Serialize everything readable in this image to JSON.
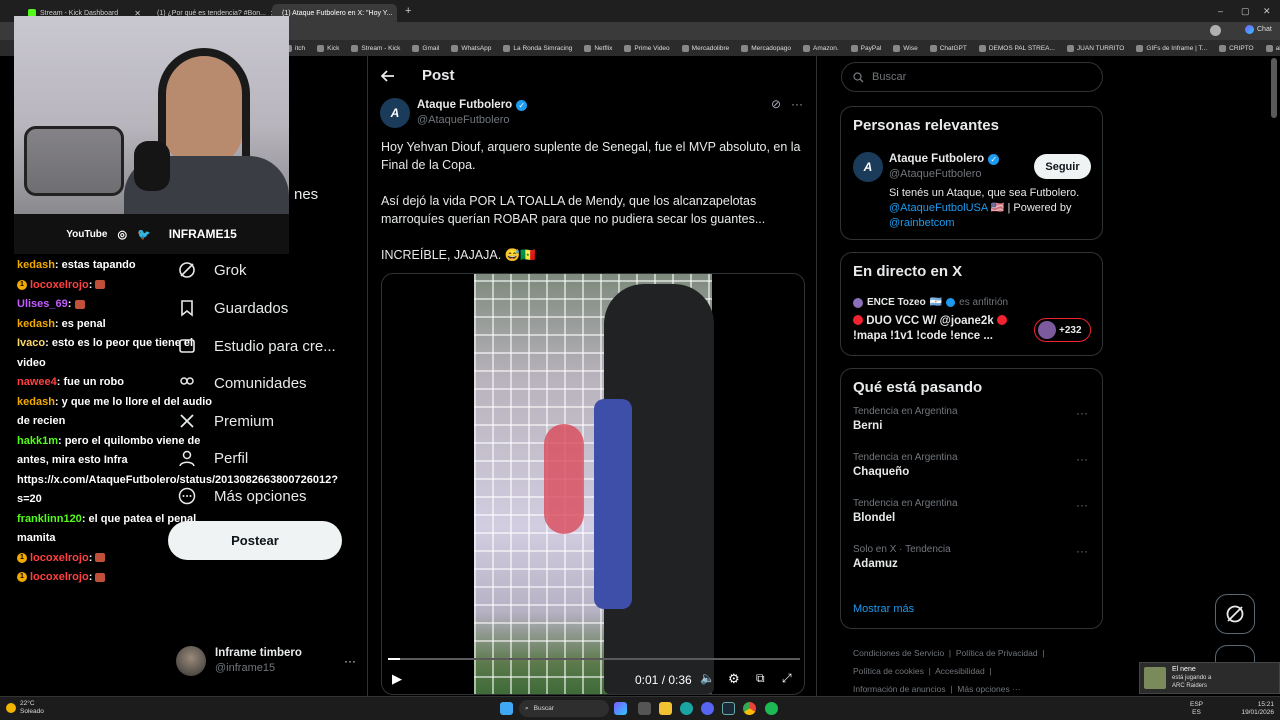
{
  "browser": {
    "tabs": [
      {
        "title": "Stream - Kick Dashboard",
        "active": false
      },
      {
        "title": "(1) ¿Por qué es tendencia? #Bon...",
        "active": false
      },
      {
        "title": "(1) Ataque Futbolero en X: \"Hoy Y...",
        "active": true
      }
    ],
    "bookmarks": [
      "itch",
      "Kick",
      "Stream - Kick",
      "Gmail",
      "WhatsApp",
      "La Ronda Simracing",
      "Netflix",
      "Prime Video",
      "Mercadolibre",
      "Mercadopago",
      "Amazon.",
      "PayPal",
      "Wise",
      "ChatGPT",
      "DEMOS PAL STREA...",
      "JUAN TURRITO",
      "GIFs de Inframe | T...",
      "CRIPTO",
      "aires"
    ],
    "chat_label": "Chat"
  },
  "webcam": {
    "youtube_label": "YouTube",
    "channel_name": "INFRAME15"
  },
  "chat": [
    {
      "user": "kedash",
      "color": "#f2a900",
      "badge": false,
      "text": ": estas tapando",
      "emote": false
    },
    {
      "user": "locoxelrojo",
      "color": "#ff4040",
      "badge": true,
      "text": ":",
      "emote": true
    },
    {
      "user": "Ulises_69",
      "color": "#c45cff",
      "badge": false,
      "text": ":",
      "emote": true
    },
    {
      "user": "kedash",
      "color": "#f2a900",
      "badge": false,
      "text": ": es penal",
      "emote": false
    },
    {
      "user": "Ivaco",
      "color": "#ffd86b",
      "badge": false,
      "text": ": esto es lo peor que tiene el video",
      "emote": false
    },
    {
      "user": "nawee4",
      "color": "#ff4040",
      "badge": false,
      "text": ": fue un robo",
      "emote": false
    },
    {
      "user": "kedash",
      "color": "#f2a900",
      "badge": false,
      "text": ": y que me lo llore el del audio de recien",
      "emote": false
    },
    {
      "user": "hakk1m",
      "color": "#53fc18",
      "badge": false,
      "text": ": pero el quilombo viene de antes, mira esto Infra https://x.com/AtaqueFutbolero/status/2013082663800726012?s=20",
      "emote": false
    },
    {
      "user": "franklinn120",
      "color": "#53fc18",
      "badge": false,
      "text": ": el que patea el penal mamita",
      "emote": false
    },
    {
      "user": "locoxelrojo",
      "color": "#ff4040",
      "badge": true,
      "text": ":",
      "emote": true
    },
    {
      "user": "locoxelrojo",
      "color": "#ff4040",
      "badge": true,
      "text": ":",
      "emote": true
    }
  ],
  "nav": {
    "items": [
      {
        "label": "nes",
        "icon": "list-icon"
      },
      {
        "label": "Grok",
        "icon": "grok-icon"
      },
      {
        "label": "Guardados",
        "icon": "bookmark-icon"
      },
      {
        "label": "Estudio para cre...",
        "icon": "studio-icon"
      },
      {
        "label": "Comunidades",
        "icon": "communities-icon"
      },
      {
        "label": "Premium",
        "icon": "x-icon"
      },
      {
        "label": "Perfil",
        "icon": "profile-icon"
      },
      {
        "label": "Más opciones",
        "icon": "more-icon"
      }
    ],
    "post_button": "Postear",
    "account": {
      "name": "Inframe timbero",
      "handle": "@inframe15"
    }
  },
  "post": {
    "header": "Post",
    "author": {
      "name": "Ataque Futbolero",
      "handle": "@AtaqueFutbolero",
      "verified": true
    },
    "paragraphs": [
      "Hoy Yehvan Diouf, arquero suplente de Senegal, fue el MVP absoluto, en la Final de la Copa.",
      "Así dejó la vida POR LA TOALLA de Mendy, que los alcanzapelotas marroquíes querían ROBAR para que no pudiera secar los guantes...",
      "INCREÍBLE, JAJAJA. 😅🇸🇳"
    ],
    "video": {
      "time": "0:01 / 0:36",
      "progress": 0.028
    }
  },
  "sidebar": {
    "search_placeholder": "Buscar",
    "relevant": {
      "title": "Personas relevantes",
      "name": "Ataque Futbolero",
      "handle": "@AtaqueFutbolero",
      "follow": "Seguir",
      "bio_a": "Si tenés un Ataque, que sea Futbolero.",
      "bio_link1": "@AtaqueFutbolUSA",
      "bio_flag": "🇺🇸",
      "bio_b": "| Powered by",
      "bio_link2": "@rainbetcom"
    },
    "live": {
      "title": "En directo en X",
      "host": "ENCE Tozeo",
      "host_flag": "🇦🇷",
      "host_role": "es anfitrión",
      "space_title": "DUO VCC W/ @joane2k",
      "space_sub": "!mapa !1v1 !code !ence ...",
      "count": "+232"
    },
    "trends": {
      "title": "Qué está pasando",
      "items": [
        {
          "context": "Tendencia en Argentina",
          "topic": "Berni"
        },
        {
          "context": "Tendencia en Argentina",
          "topic": "Chaqueño"
        },
        {
          "context": "Tendencia en Argentina",
          "topic": "Blondel"
        },
        {
          "context": "Solo en X · Tendencia",
          "topic": "Adamuz"
        }
      ],
      "show_more": "Mostrar más"
    },
    "footer": {
      "line1": [
        "Condiciones de Servicio",
        "Política de Privacidad"
      ],
      "line2": [
        "Política de cookies",
        "Accesibilidad"
      ],
      "line3": [
        "Información de anuncios",
        "Más opciones ···"
      ]
    }
  },
  "toast": {
    "title": "El nene",
    "line2": "está jugando a",
    "game": "ARC Raiders"
  },
  "taskbar": {
    "weather_temp": "22°C",
    "weather_desc": "Soleado",
    "search": "Buscar",
    "lang1": "ESP",
    "lang2": "ES",
    "time": "15:21",
    "date": "19/01/2026"
  },
  "colors": {
    "accent": "#1d9bf0",
    "background": "#000000",
    "border": "#2f3336"
  }
}
